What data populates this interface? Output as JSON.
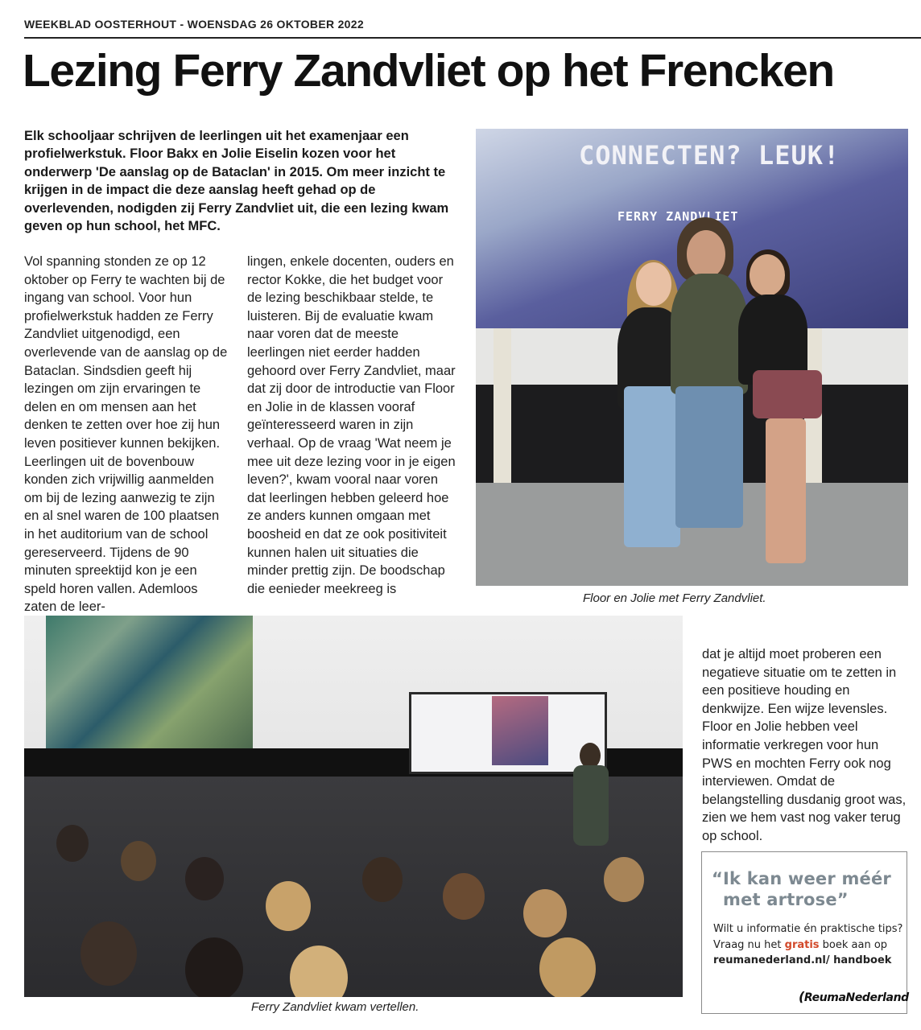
{
  "masthead": "WEEKBLAD OOSTERHOUT - WOENSDAG 26 OKTOBER 2022",
  "headline": "Lezing Ferry Zandvliet op het Frencken",
  "lead": "Elk schooljaar schrijven de leerlingen uit het examenjaar een profielwerkstuk. Floor Bakx en Jolie Eiselin kozen voor het onderwerp 'De aanslag op de Bataclan' in 2015. Om meer inzicht te krijgen in de impact die deze aanslag heeft gehad op de overlevenden, nodigden zij Ferry Zandvliet uit, die een lezing kwam geven op hun school, het MFC.",
  "body": {
    "col1": "Vol spanning stonden ze op 12 oktober op Ferry te wachten bij de ingang van school. Voor hun profielwerkstuk hadden ze Ferry Zandvliet uitgenodigd, een overlevende van de aanslag op de Bataclan. Sindsdien geeft hij lezingen om zijn ervaringen te delen en om mensen aan het denken te zetten over hoe zij hun leven positiever kunnen bekijken. Leerlingen uit de bovenbouw konden zich vrijwillig aanmelden om bij de lezing aanwezig te zijn en al snel waren de 100 plaatsen in het auditorium van de school gereserveerd. Tijdens de 90 minuten spreektijd kon je een speld horen vallen. Ademloos zaten de leer-",
    "col2": "lingen, enkele docenten, ouders en rector Kokke, die het budget voor de lezing beschikbaar stelde, te luisteren. Bij de evaluatie kwam naar voren dat de meeste leerlingen niet eerder hadden gehoord over Ferry Zandvliet, maar dat zij door de introductie van Floor en Jolie in de klassen vooraf geïnteresseerd waren in zijn verhaal. Op de vraag 'Wat neem je mee uit deze lezing voor in je eigen leven?', kwam vooral naar voren dat leerlingen hebben geleerd hoe ze anders kunnen omgaan met boosheid en dat ze ook positiviteit kunnen halen uit situaties die minder prettig zijn. De boodschap die eenieder meekreeg is",
    "col3": "dat je altijd moet proberen een negatieve situatie om te zetten in een positieve houding en denkwijze. Een wijze levensles. Floor en Jolie hebben veel informatie verkregen voor hun PWS en mochten Ferry ook nog interviewen. Omdat de belangstelling dusdanig groot was, zien we hem vast nog vaker terug op school."
  },
  "photo1": {
    "screen_title": "CONNECTEN? LEUK!",
    "screen_name": "FERRY ZANDVLIET",
    "caption": "Floor en Jolie met Ferry Zandvliet."
  },
  "photo2": {
    "caption": "Ferry Zandvliet kwam vertellen."
  },
  "ad": {
    "quote_line1": "“Ik kan weer méér",
    "quote_line2": "met artrose”",
    "text1": "Wilt u informatie én praktische tips? Vraag nu het ",
    "highlight": "gratis",
    "text2": " boek aan op ",
    "link": "reumanederland.nl/ handboek",
    "logo": "ReumaNederland"
  },
  "colors": {
    "ad_quote": "#7d8991",
    "ad_highlight": "#d2492a",
    "rule": "#222222"
  }
}
